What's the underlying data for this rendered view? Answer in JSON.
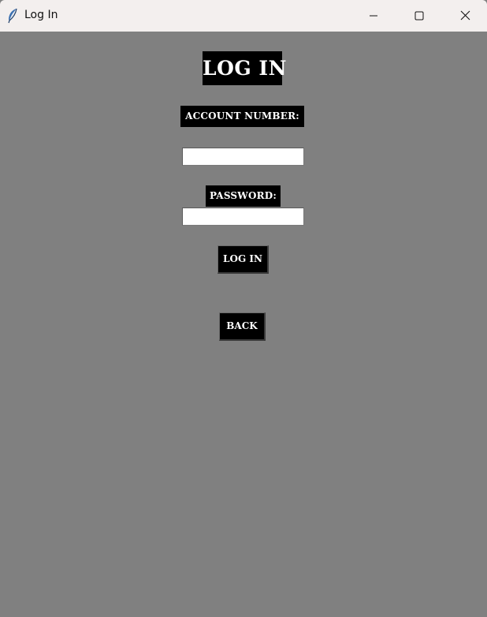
{
  "window": {
    "title": "Log In",
    "app_icon": "feather-icon",
    "controls": {
      "minimize_icon": "minimize-icon",
      "maximize_icon": "maximize-icon",
      "close_icon": "close-icon"
    }
  },
  "form": {
    "heading": "LOG IN",
    "account_label": "ACCOUNT NUMBER:",
    "account_value": "",
    "password_label": "PASSWORD:",
    "password_value": "",
    "login_button": "LOG IN",
    "back_button": "BACK"
  },
  "colors": {
    "background": "#808080",
    "label_background": "#000000",
    "label_text": "#ffffff",
    "titlebar": "#f3efee"
  }
}
